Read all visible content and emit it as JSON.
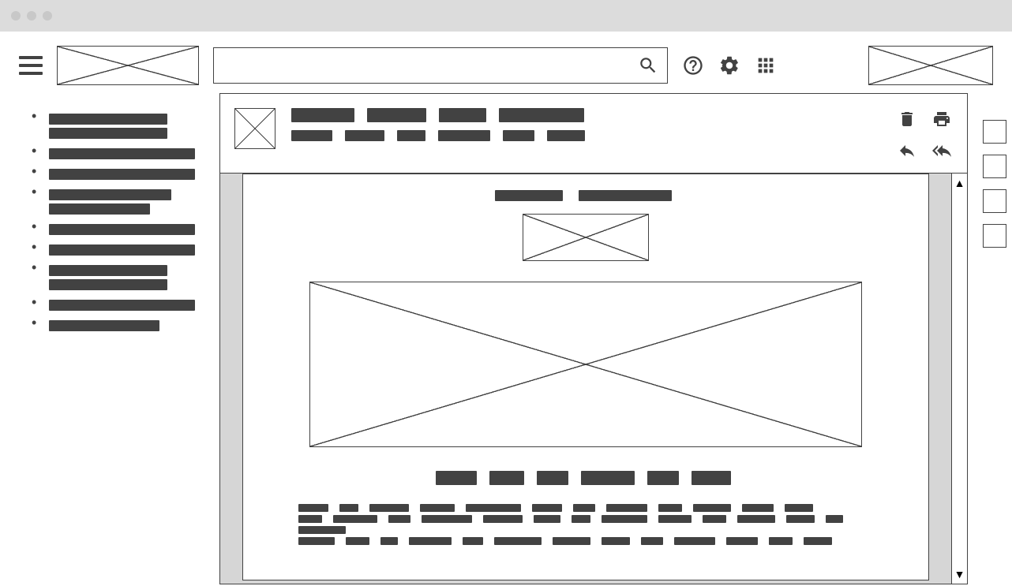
{
  "search": {
    "placeholder": ""
  },
  "sidebar": {
    "items": [
      {
        "segments": [
          150,
          150
        ]
      },
      {
        "segments": [
          185
        ]
      },
      {
        "segments": [
          185
        ]
      },
      {
        "segments": [
          155,
          128
        ]
      },
      {
        "segments": [
          185
        ]
      },
      {
        "segments": [
          185
        ]
      },
      {
        "segments": [
          150,
          150
        ]
      },
      {
        "segments": [
          185
        ]
      },
      {
        "segments": [
          140
        ]
      }
    ]
  },
  "email": {
    "subject_segments": [
      80,
      75,
      60,
      108
    ],
    "from_segments": [
      52,
      50,
      36,
      66,
      40,
      48
    ],
    "body": {
      "top_segments": [
        86,
        118
      ],
      "title_segments": [
        52,
        44,
        40,
        68,
        40,
        50
      ],
      "paragraphs": [
        [
          38,
          24,
          50,
          44,
          70,
          38,
          28,
          52,
          30,
          48,
          40,
          36
        ],
        [
          30,
          56,
          28,
          64,
          50,
          34,
          24,
          58,
          42,
          30,
          48,
          36,
          22
        ],
        [
          60
        ],
        [
          46,
          30,
          22,
          54,
          26,
          60,
          48,
          36,
          28,
          52,
          40,
          30,
          36
        ]
      ]
    }
  },
  "scrollbar": {
    "up": "▲",
    "down": "▼"
  }
}
